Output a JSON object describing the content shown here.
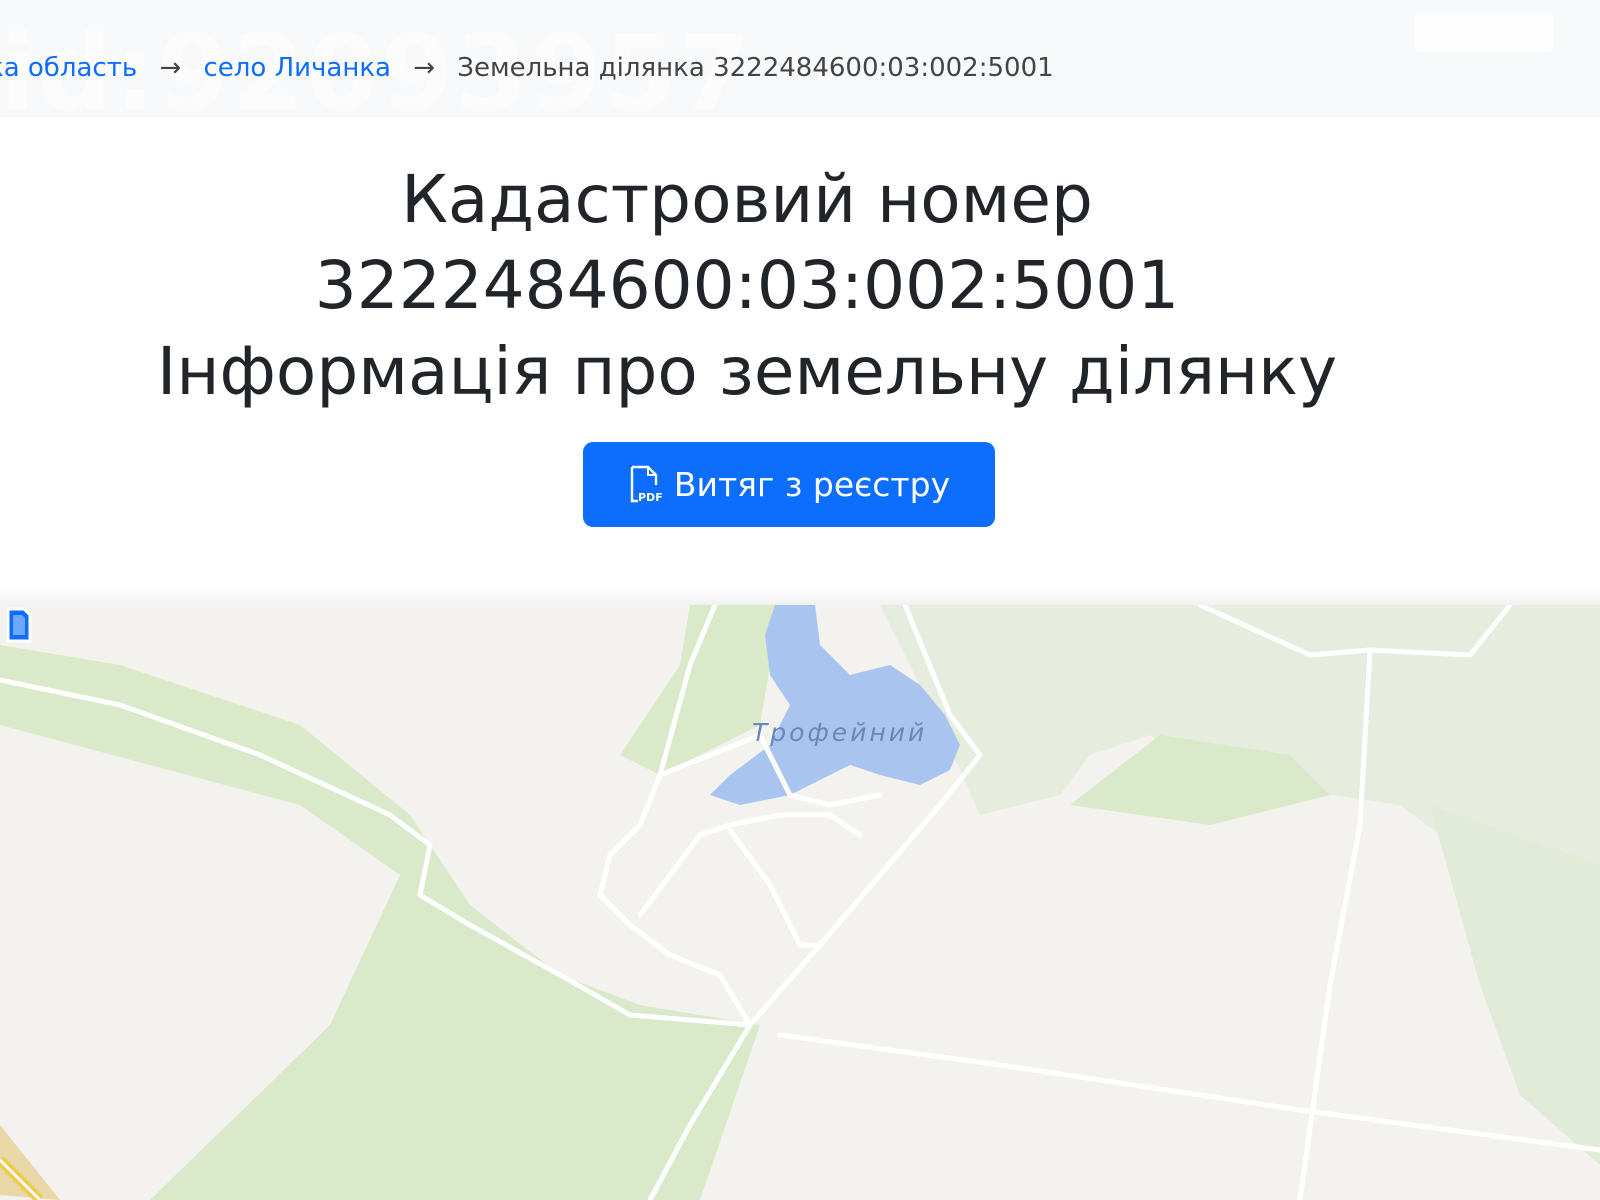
{
  "breadcrumb": {
    "items": [
      {
        "label": "ка область"
      },
      {
        "label": "село Личанка"
      }
    ],
    "separator": "→",
    "current": "Земельна ділянка 3222484600:03:002:5001"
  },
  "watermark": {
    "text": "id:92093957"
  },
  "heading": {
    "line1": "Кадастровий номер",
    "line2": "3222484600:03:002:5001",
    "line3": "Інформація про земельну ділянку"
  },
  "extract_button": {
    "label": "Витяг з реєстру",
    "icon": "pdf-file-icon"
  },
  "map": {
    "lake_label": "Трофейний",
    "marker_icon": "parcel-marker-icon"
  },
  "colors": {
    "accent": "#0d6efd",
    "water": "#aac6ee",
    "forest": "#d6e8c4",
    "land": "#f4f2ee"
  }
}
